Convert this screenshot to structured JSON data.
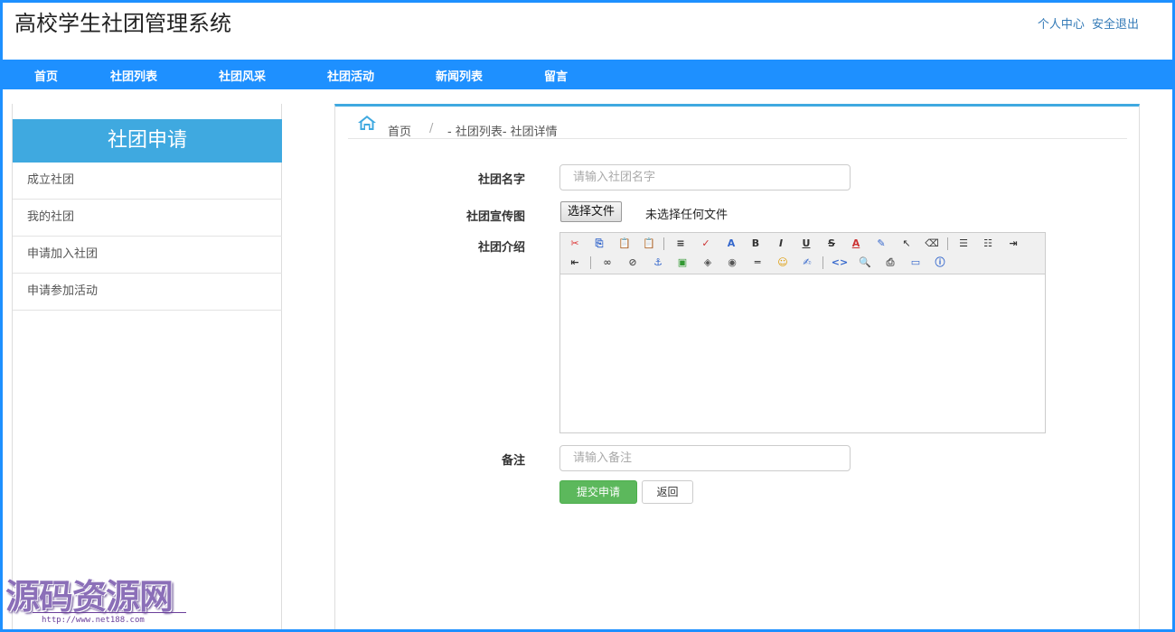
{
  "header": {
    "site_title": "高校学生社团管理系统",
    "user_center": "个人中心",
    "logout": "安全退出"
  },
  "nav": {
    "items": [
      "首页",
      "社团列表",
      "社团风采",
      "社团活动",
      "新闻列表",
      "留言"
    ]
  },
  "sidebar": {
    "title": "社团申请",
    "items": [
      "成立社团",
      "我的社团",
      "申请加入社团",
      "申请参加活动"
    ]
  },
  "breadcrumb": {
    "home": "首页",
    "separator": "/",
    "path": "- 社团列表- 社团详情"
  },
  "form": {
    "name_label": "社团名字",
    "name_placeholder": "请输入社团名字",
    "image_label": "社团宣传图",
    "file_button": "选择文件",
    "file_status": "未选择任何文件",
    "intro_label": "社团介绍",
    "remark_label": "备注",
    "remark_placeholder": "请输入备注",
    "submit": "提交申请",
    "back": "返回"
  },
  "editor": {
    "toolbar_icons": [
      "cut-icon",
      "copy-icon",
      "paste-icon",
      "paste-text-icon",
      "align-icon",
      "spellcheck-icon",
      "font-icon",
      "bold-icon",
      "italic-icon",
      "underline-icon",
      "strikethrough-icon",
      "font-color-icon",
      "highlight-icon",
      "select-icon",
      "eraser-icon",
      "align-left-icon",
      "ordered-list-icon",
      "indent-icon",
      "outdent-icon",
      "link-icon",
      "unlink-icon",
      "anchor-icon",
      "image-icon",
      "flash-icon",
      "media-icon",
      "horizontal-rule-icon",
      "emoticon-icon",
      "note-icon",
      "source-icon",
      "preview-icon",
      "print-icon",
      "fullscreen-icon",
      "about-icon"
    ]
  },
  "watermark": {
    "text": "源码资源网",
    "url": "http://www.net188.com"
  },
  "colors": {
    "nav_bg": "#1e90ff",
    "sidebar_header_bg": "#3fa9e0",
    "submit_bg": "#5cb85c",
    "link": "#337ab7"
  }
}
